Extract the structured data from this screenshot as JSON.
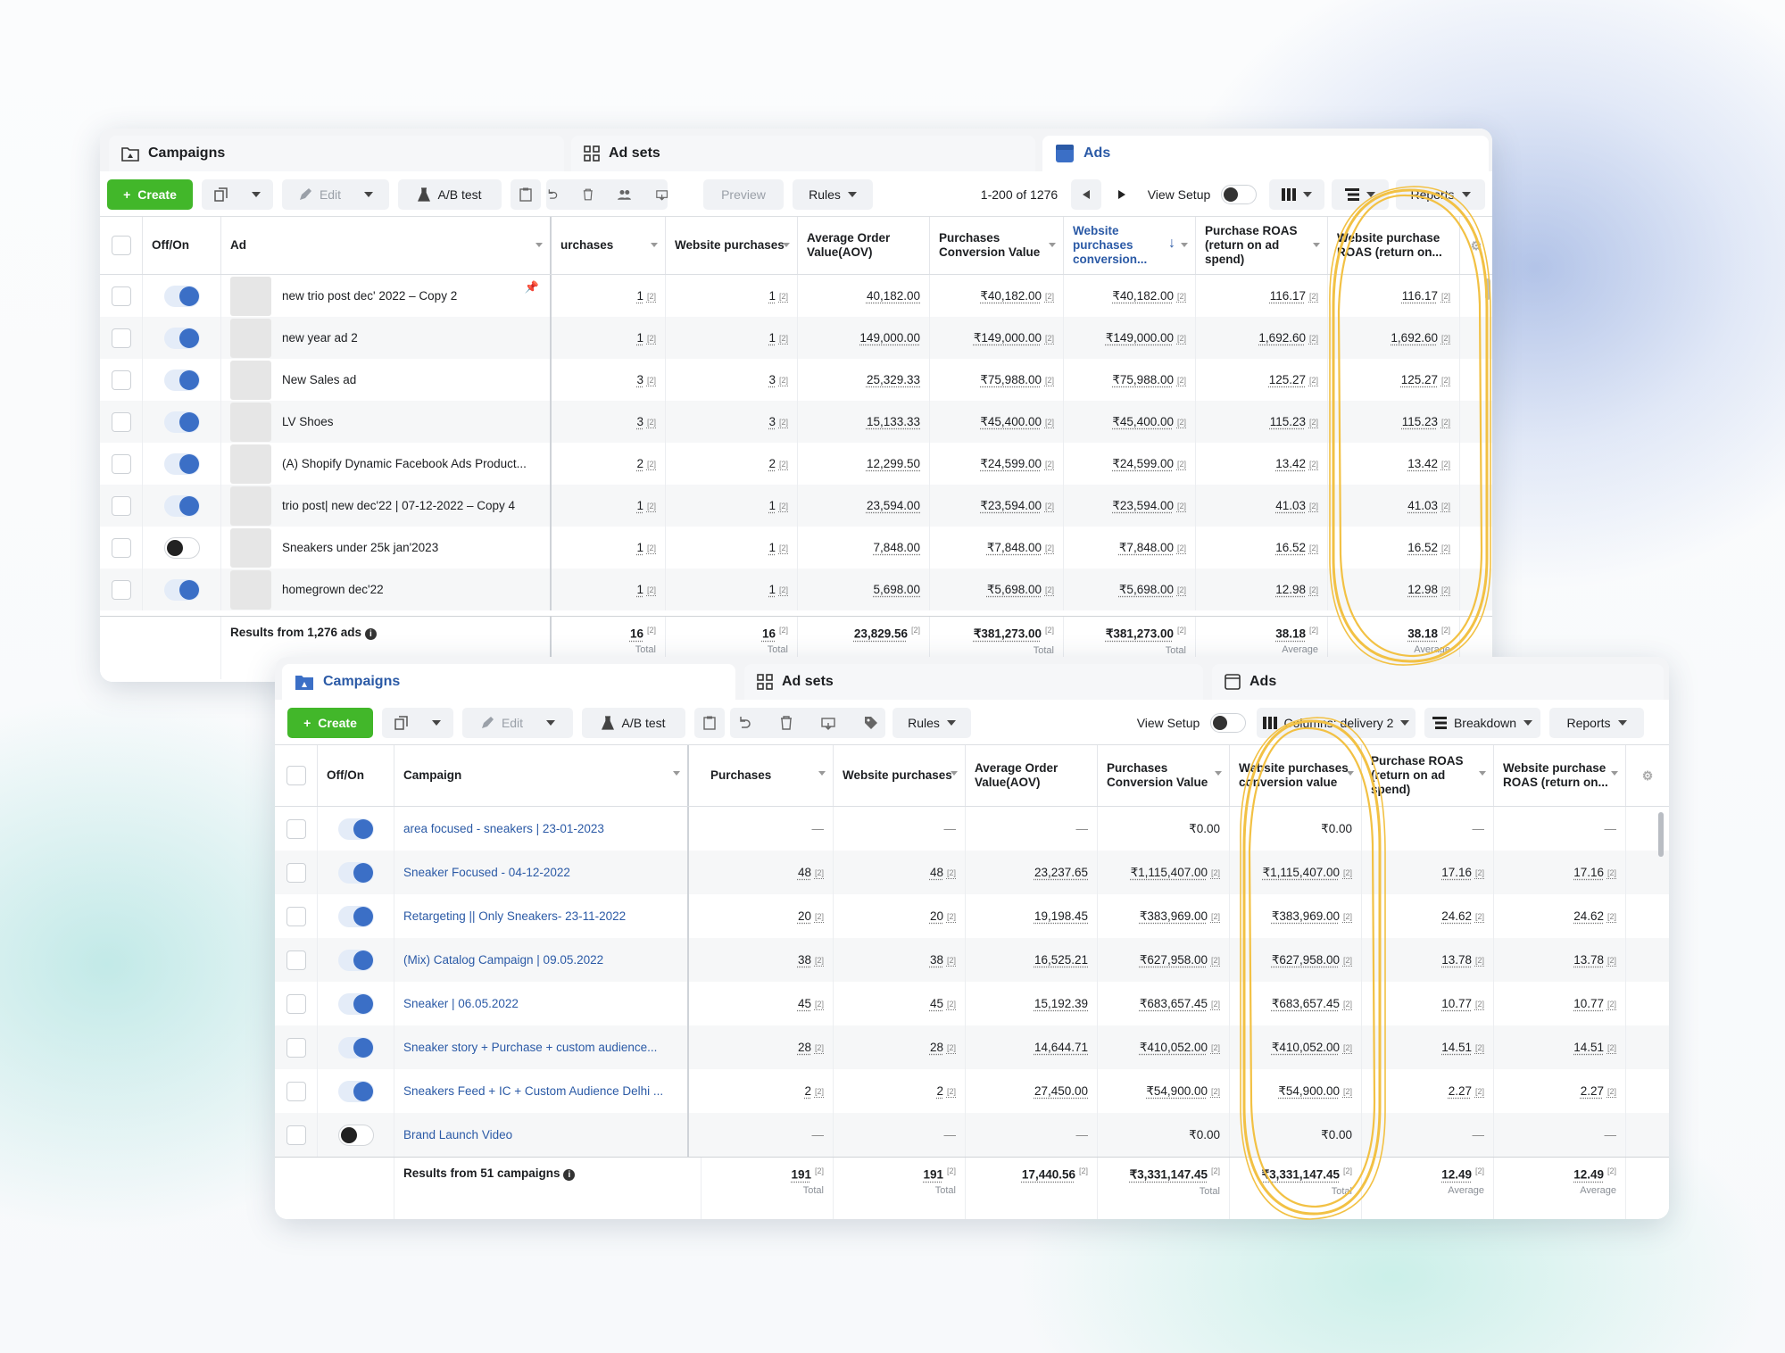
{
  "top": {
    "tabs": [
      "Campaigns",
      "Ad sets",
      "Ads"
    ],
    "toolbar": {
      "create": "Create",
      "edit": "Edit",
      "ab_test": "A/B test",
      "preview": "Preview",
      "rules": "Rules",
      "pagination": "1-200 of 1276",
      "view_setup": "View Setup",
      "reports": "Reports"
    },
    "headers": [
      "Off/On",
      "Ad",
      "urchases",
      "Website purchases",
      "Average Order Value(AOV)",
      "Purchases Conversion Value",
      "Website purchases conversion...",
      "Purchase ROAS (return on ad spend)",
      "Website purchase ROAS (return on..."
    ],
    "rows": [
      {
        "name": "new trio post dec' 2022 – Copy 2",
        "on": true,
        "purchases": "1",
        "web_purchases": "1",
        "aov": "40,182.00",
        "pcv": "₹40,182.00",
        "wpcv": "₹40,182.00",
        "roas": "116.17",
        "wroas": "116.17"
      },
      {
        "name": "new year ad 2",
        "on": true,
        "purchases": "1",
        "web_purchases": "1",
        "aov": "149,000.00",
        "pcv": "₹149,000.00",
        "wpcv": "₹149,000.00",
        "roas": "1,692.60",
        "wroas": "1,692.60"
      },
      {
        "name": "New Sales ad",
        "on": true,
        "purchases": "3",
        "web_purchases": "3",
        "aov": "25,329.33",
        "pcv": "₹75,988.00",
        "wpcv": "₹75,988.00",
        "roas": "125.27",
        "wroas": "125.27"
      },
      {
        "name": "LV Shoes",
        "on": true,
        "purchases": "3",
        "web_purchases": "3",
        "aov": "15,133.33",
        "pcv": "₹45,400.00",
        "wpcv": "₹45,400.00",
        "roas": "115.23",
        "wroas": "115.23"
      },
      {
        "name": "(A) Shopify Dynamic Facebook Ads Product...",
        "on": true,
        "purchases": "2",
        "web_purchases": "2",
        "aov": "12,299.50",
        "pcv": "₹24,599.00",
        "wpcv": "₹24,599.00",
        "roas": "13.42",
        "wroas": "13.42"
      },
      {
        "name": "trio post| new dec'22 | 07-12-2022 – Copy 4",
        "on": true,
        "purchases": "1",
        "web_purchases": "1",
        "aov": "23,594.00",
        "pcv": "₹23,594.00",
        "wpcv": "₹23,594.00",
        "roas": "41.03",
        "wroas": "41.03"
      },
      {
        "name": "Sneakers under 25k jan'2023",
        "on": false,
        "purchases": "1",
        "web_purchases": "1",
        "aov": "7,848.00",
        "pcv": "₹7,848.00",
        "wpcv": "₹7,848.00",
        "roas": "16.52",
        "wroas": "16.52"
      },
      {
        "name": "homegrown dec'22",
        "on": true,
        "purchases": "1",
        "web_purchases": "1",
        "aov": "5,698.00",
        "pcv": "₹5,698.00",
        "wpcv": "₹5,698.00",
        "roas": "12.98",
        "wroas": "12.98"
      }
    ],
    "footer": {
      "label": "Results from 1,276 ads",
      "purchases": "16",
      "web_purchases": "16",
      "aov": "23,829.56",
      "pcv": "₹381,273.00",
      "wpcv": "₹381,273.00",
      "roas": "38.18",
      "wroas": "38.18",
      "total": "Total",
      "average": "Average"
    }
  },
  "bottom": {
    "tabs": [
      "Campaigns",
      "Ad sets",
      "Ads"
    ],
    "toolbar": {
      "create": "Create",
      "edit": "Edit",
      "ab_test": "A/B test",
      "rules": "Rules",
      "view_setup": "View Setup",
      "columns": "Columns: delivery 2",
      "breakdown": "Breakdown",
      "reports": "Reports"
    },
    "headers": [
      "Off/On",
      "Campaign",
      "Purchases",
      "Website purchases",
      "Average Order Value(AOV)",
      "Purchases Conversion Value",
      "Website purchases conversion value",
      "Purchase ROAS (return on ad spend)",
      "Website purchase ROAS (return on..."
    ],
    "rows": [
      {
        "name": "area focused - sneakers | 23-01-2023",
        "on": true,
        "purchases": "—",
        "web_purchases": "—",
        "aov": "—",
        "pcv": "₹0.00",
        "wpcv": "₹0.00",
        "roas": "—",
        "wroas": "—"
      },
      {
        "name": "Sneaker Focused - 04-12-2022",
        "on": true,
        "purchases": "48",
        "web_purchases": "48",
        "aov": "23,237.65",
        "pcv": "₹1,115,407.00",
        "wpcv": "₹1,115,407.00",
        "roas": "17.16",
        "wroas": "17.16"
      },
      {
        "name": "Retargeting || Only Sneakers- 23-11-2022",
        "on": true,
        "purchases": "20",
        "web_purchases": "20",
        "aov": "19,198.45",
        "pcv": "₹383,969.00",
        "wpcv": "₹383,969.00",
        "roas": "24.62",
        "wroas": "24.62"
      },
      {
        "name": "(Mix) Catalog Campaign | 09.05.2022",
        "on": true,
        "purchases": "38",
        "web_purchases": "38",
        "aov": "16,525.21",
        "pcv": "₹627,958.00",
        "wpcv": "₹627,958.00",
        "roas": "13.78",
        "wroas": "13.78"
      },
      {
        "name": "Sneaker | 06.05.2022",
        "on": true,
        "purchases": "45",
        "web_purchases": "45",
        "aov": "15,192.39",
        "pcv": "₹683,657.45",
        "wpcv": "₹683,657.45",
        "roas": "10.77",
        "wroas": "10.77"
      },
      {
        "name": "Sneaker story + Purchase + custom audience...",
        "on": true,
        "purchases": "28",
        "web_purchases": "28",
        "aov": "14,644.71",
        "pcv": "₹410,052.00",
        "wpcv": "₹410,052.00",
        "roas": "14.51",
        "wroas": "14.51"
      },
      {
        "name": "Sneakers Feed + IC + Custom Audience Delhi ...",
        "on": true,
        "purchases": "2",
        "web_purchases": "2",
        "aov": "27,450.00",
        "pcv": "₹54,900.00",
        "wpcv": "₹54,900.00",
        "roas": "2.27",
        "wroas": "2.27"
      },
      {
        "name": "Brand Launch Video",
        "on": false,
        "purchases": "—",
        "web_purchases": "—",
        "aov": "—",
        "pcv": "₹0.00",
        "wpcv": "₹0.00",
        "roas": "—",
        "wroas": "—"
      }
    ],
    "footer": {
      "label": "Results from 51 campaigns",
      "purchases": "191",
      "web_purchases": "191",
      "aov": "17,440.56",
      "pcv": "₹3,331,147.45",
      "wpcv": "₹3,331,147.45",
      "roas": "12.49",
      "wroas": "12.49",
      "total": "Total",
      "average": "Average"
    }
  },
  "colors": {
    "accent": "#2b5aa6",
    "create_green": "#42b72a",
    "toggle_blue": "#3b6fc6",
    "highlight_circle": "#f2c144"
  },
  "icons": [
    "campaign-folder-icon",
    "adsets-grid-icon",
    "ads-square-icon",
    "plus-icon",
    "duplicate-icon",
    "pencil-icon",
    "flask-icon",
    "clipboard-icon",
    "undo-icon",
    "trash-icon",
    "people-icon",
    "export-icon",
    "tag-icon",
    "columns-icon",
    "breakdown-icon",
    "info-icon",
    "pin-icon",
    "sort-down-icon",
    "settings-icon",
    "prev-icon",
    "next-icon"
  ]
}
